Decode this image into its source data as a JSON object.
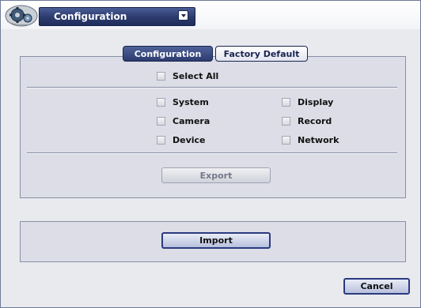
{
  "window": {
    "title": "Configuration"
  },
  "tabs": [
    {
      "label": "Configuration",
      "active": true
    },
    {
      "label": "Factory Default",
      "active": false
    }
  ],
  "select_all": {
    "label": "Select All",
    "checked": false
  },
  "options": [
    {
      "label": "System",
      "checked": false
    },
    {
      "label": "Display",
      "checked": false
    },
    {
      "label": "Camera",
      "checked": false
    },
    {
      "label": "Record",
      "checked": false
    },
    {
      "label": "Device",
      "checked": false
    },
    {
      "label": "Network",
      "checked": false
    }
  ],
  "buttons": {
    "export": "Export",
    "import": "Import",
    "cancel": "Cancel"
  },
  "icons": {
    "logo": "gear-logo-icon",
    "title_dropdown": "chevron-down-icon"
  },
  "colors": {
    "title_bar": "#2b3a6d",
    "panel": "#dcdde6",
    "window_bg": "#e9eaee",
    "button_border": "#2a3a80"
  }
}
